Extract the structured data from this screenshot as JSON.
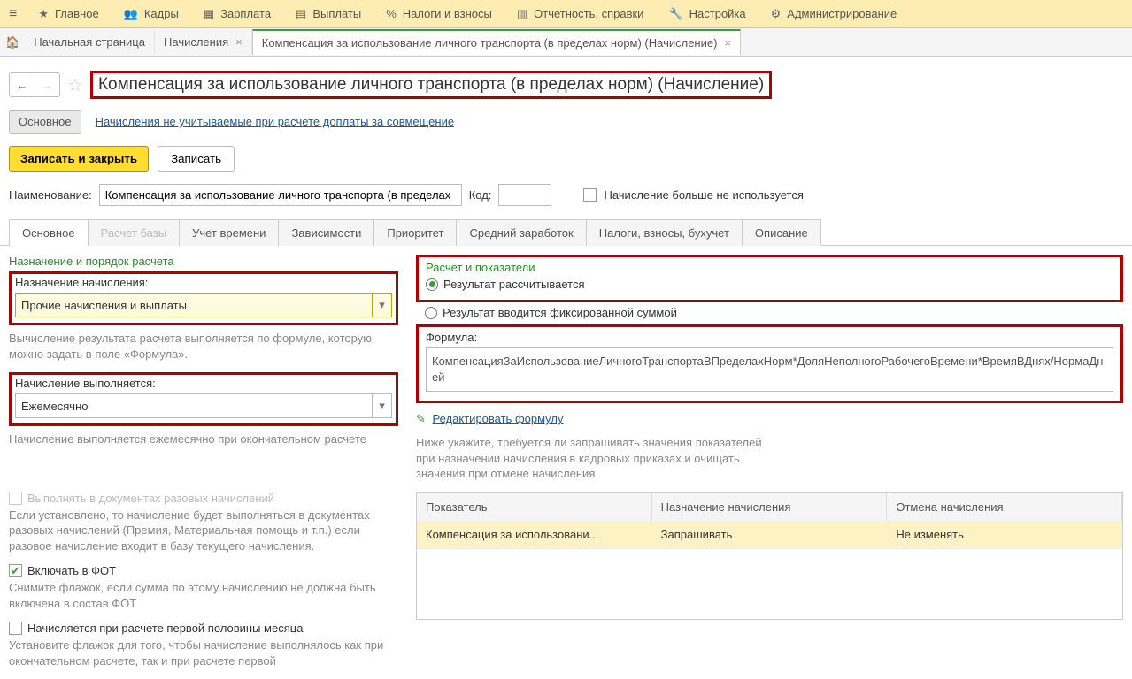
{
  "topmenu": {
    "items": [
      {
        "label": "Главное"
      },
      {
        "label": "Кадры"
      },
      {
        "label": "Зарплата"
      },
      {
        "label": "Выплаты"
      },
      {
        "label": "Налоги и взносы"
      },
      {
        "label": "Отчетность, справки"
      },
      {
        "label": "Настройка"
      },
      {
        "label": "Администрирование"
      }
    ]
  },
  "tabs": {
    "home": "Начальная страница",
    "t1": "Начисления",
    "t2": "Компенсация за использование личного транспорта (в пределах норм) (Начисление)"
  },
  "title": "Компенсация за использование личного транспорта (в пределах норм) (Начисление)",
  "linkrow": {
    "main": "Основное",
    "link": "Начисления не учитываемые при расчете доплаты за совмещение"
  },
  "cmd": {
    "save_close": "Записать и закрыть",
    "save": "Записать"
  },
  "fields": {
    "name_label": "Наименование:",
    "name_value": "Компенсация за использование личного транспорта (в пределах",
    "code_label": "Код:",
    "code_value": "",
    "deprecated": "Начисление больше не используется"
  },
  "inner_tabs": [
    "Основное",
    "Расчет базы",
    "Учет времени",
    "Зависимости",
    "Приоритет",
    "Средний заработок",
    "Налоги, взносы, бухучет",
    "Описание"
  ],
  "left": {
    "sh1": "Назначение и порядок расчета",
    "purpose_label": "Назначение начисления:",
    "purpose_value": "Прочие начисления и выплаты",
    "help1": "Вычисление результата расчета выполняется по формуле, которую можно задать в поле «Формула».",
    "period_label": "Начисление выполняется:",
    "period_value": "Ежемесячно",
    "help2": "Начисление выполняется ежемесячно при окончательном расчете",
    "chk1": "Выполнять в документах разовых начислений",
    "help3": "Если установлено, то начисление будет выполняться в документах разовых начислений (Премия, Материальная помощь и т.п.) если разовое начисление входит в базу текущего начисления.",
    "chk2": "Включать в ФОТ",
    "help4": "Снимите флажок, если сумма по этому начислению не должна быть включена в состав ФОТ",
    "chk3": "Начисляется при расчете первой половины месяца",
    "help5": "Установите флажок для того, чтобы начисление выполнялось как при окончательном расчете, так и при расчете первой"
  },
  "right": {
    "sh": "Расчет и показатели",
    "r1": "Результат рассчитывается",
    "r2": "Результат вводится фиксированной суммой",
    "formula_label": "Формула:",
    "formula": "КомпенсацияЗаИспользованиеЛичногоТранспортаВПределахНорм*ДоляНеполногоРабочегоВремени*ВремяВДнях/НормаДней",
    "edit_link": "Редактировать формулу",
    "hint": "Ниже укажите, требуется ли запрашивать значения показателей при назначении начисления в кадровых приказах и очищать значения при отмене начисления",
    "tbl_h": [
      "Показатель",
      "Назначение начисления",
      "Отмена начисления"
    ],
    "tbl_r": [
      "Компенсация за использовани...",
      "Запрашивать",
      "Не изменять"
    ]
  }
}
